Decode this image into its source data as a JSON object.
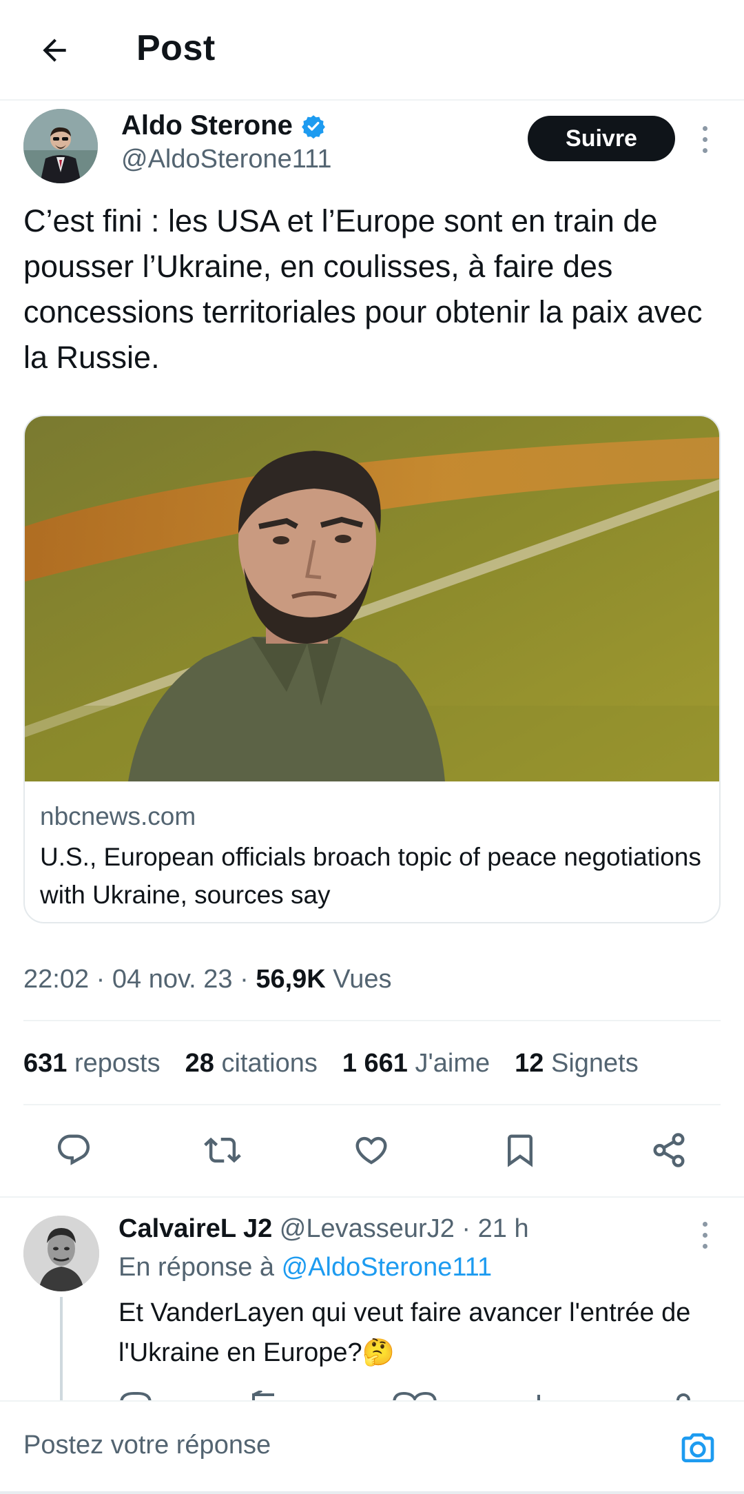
{
  "header": {
    "title": "Post"
  },
  "post": {
    "author": {
      "name": "Aldo Sterone",
      "handle": "@AldoSterone111",
      "verified": true
    },
    "follow_label": "Suivre",
    "text": "C’est fini : les USA et l’Europe sont en train de pousser l’Ukraine, en coulisses, à faire des concessions territoriales pour obtenir la paix avec la Russie.",
    "link_card": {
      "domain": "nbcnews.com",
      "title": "U.S., European officials broach topic of peace negotiations with Ukraine, sources say"
    },
    "meta": {
      "time": "22:02",
      "sep1": " · ",
      "date": "04 nov. 23",
      "sep2": " · ",
      "views_count": "56,9K",
      "views_label": " Vues"
    },
    "stats": [
      {
        "count": "631",
        "label": "reposts"
      },
      {
        "count": "28",
        "label": "citations"
      },
      {
        "count": "1 661",
        "label": "J'aime"
      },
      {
        "count": "12",
        "label": "Signets"
      }
    ],
    "actions": [
      "reply-icon",
      "repost-icon",
      "like-icon",
      "bookmark-icon",
      "share-icon"
    ]
  },
  "reply": {
    "name": "CalvaireL J2",
    "handle": "@LevasseurJ2",
    "sep": " · ",
    "time": "21 h",
    "in_reply_prefix": "En réponse à ",
    "in_reply_handle": "@AldoSterone111",
    "text": "Et VanderLayen qui veut faire avancer l'entrée de l'Ukraine en Europe?🤔"
  },
  "composer": {
    "placeholder": "Postez votre réponse",
    "icon": "camera-icon"
  },
  "colors": {
    "text": "#0f1419",
    "secondary": "#536471",
    "link": "#1d9bf0",
    "verified": "#1d9bf0",
    "divider": "#eff3f4"
  }
}
